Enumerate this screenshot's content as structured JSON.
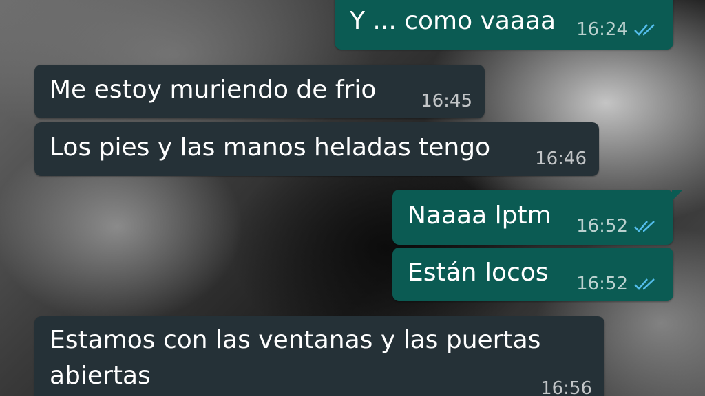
{
  "chat": {
    "messages": [
      {
        "direction": "out",
        "text": "Y ... como vaaaa",
        "time": "16:24",
        "status": "read"
      },
      {
        "direction": "in",
        "text": "Me estoy muriendo de frio",
        "time": "16:45"
      },
      {
        "direction": "in",
        "text": "Los pies y las manos heladas tengo",
        "time": "16:46"
      },
      {
        "direction": "out",
        "text": "Naaaa lptm",
        "time": "16:52",
        "status": "read"
      },
      {
        "direction": "out",
        "text": "Están locos",
        "time": "16:52",
        "status": "read"
      },
      {
        "direction": "in",
        "text_line1": "Estamos con las ventanas y las puertas",
        "text_line2": "abiertas",
        "time": "16:56"
      }
    ]
  },
  "colors": {
    "incoming_bubble": "#253137",
    "outgoing_bubble": "#0b5b53",
    "read_tick": "#53bdeb"
  },
  "icons": {
    "read_receipt": "double-check-icon"
  }
}
